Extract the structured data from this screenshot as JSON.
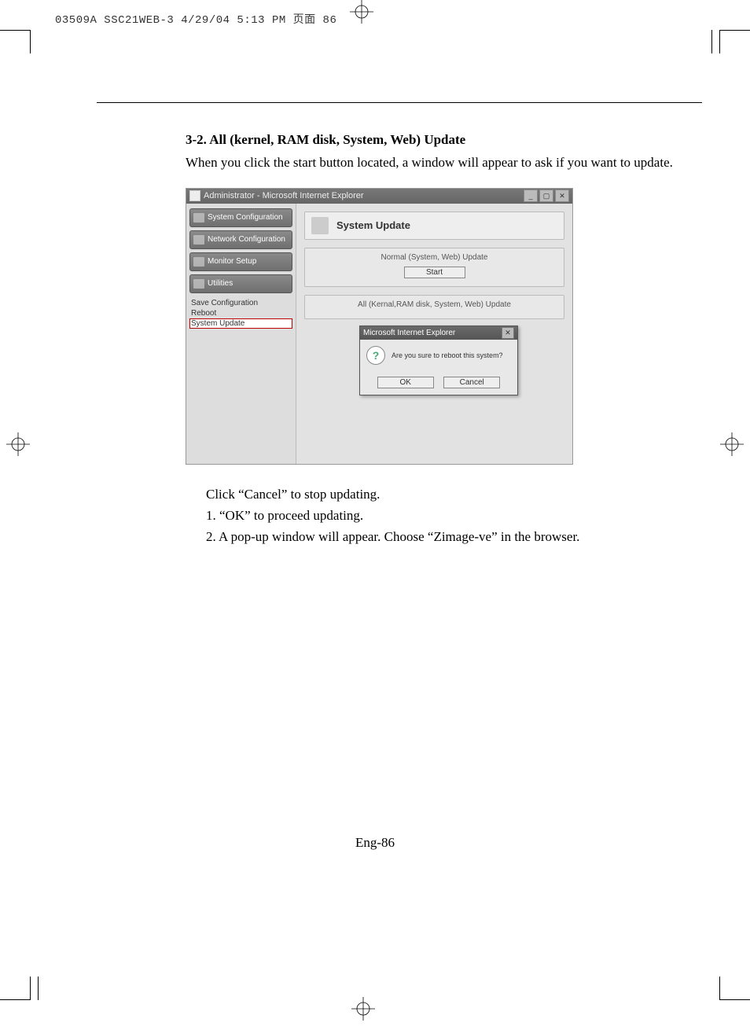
{
  "print_header": "03509A SSC21WEB-3  4/29/04  5:13 PM  页面 86",
  "heading": "3-2. All (kernel, RAM disk, System, Web) Update",
  "intro": "When you click the start button located, a window will appear to ask if you want to update.",
  "screenshot": {
    "window_title": "Administrator - Microsoft Internet Explorer",
    "nav": {
      "items": [
        "System Configuration",
        "Network Configuration",
        "Monitor Setup",
        "Utilities"
      ]
    },
    "sublist": {
      "items": [
        "Save Configuration",
        "Reboot",
        "System Update"
      ],
      "selected_index": 2
    },
    "panel_title": "System Update",
    "section1_label": "Normal (System, Web) Update",
    "start_btn": "Start",
    "section2_label": "All (Kernal,RAM disk, System, Web) Update",
    "dialog": {
      "title": "Microsoft Internet Explorer",
      "message": "Are you sure to reboot this system?",
      "ok": "OK",
      "cancel": "Cancel"
    }
  },
  "after": {
    "line0": "Click “Cancel” to stop updating.",
    "line1": "1. “OK” to proceed updating.",
    "line2": "2. A pop-up window will appear. Choose “Zimage-ve” in the browser."
  },
  "page_number": "Eng-86"
}
